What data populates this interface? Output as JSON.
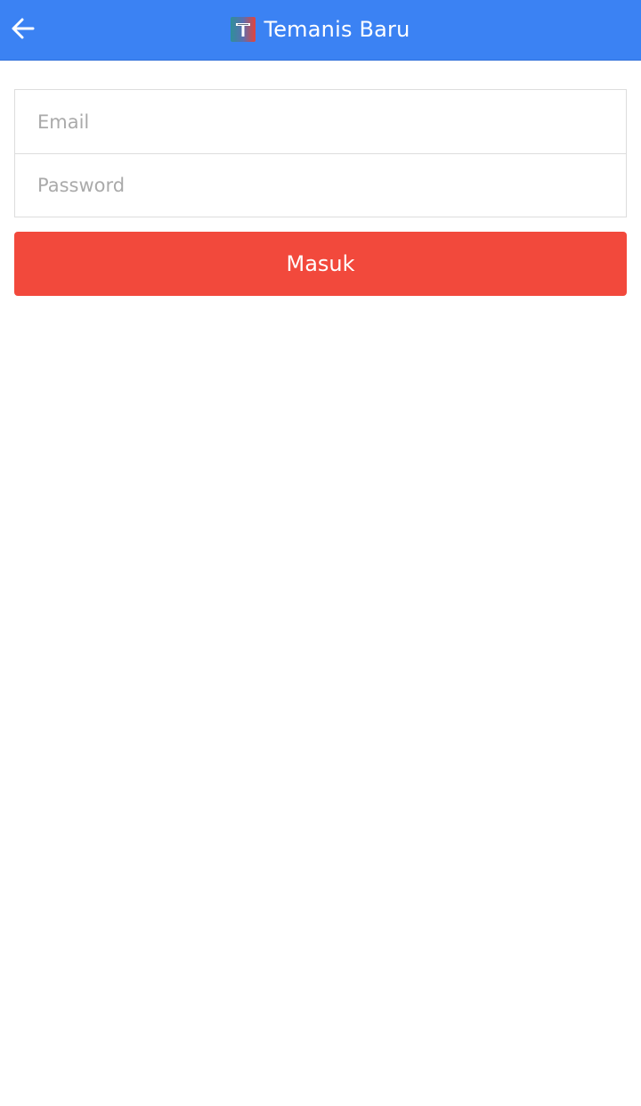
{
  "header": {
    "title": "Temanis Baru",
    "back_icon": "arrow-left-icon",
    "logo_icon": "temanis-logo-icon",
    "background_color": "#3b82f3"
  },
  "login_form": {
    "email_placeholder": "Email",
    "email_value": "",
    "password_placeholder": "Password",
    "password_value": "",
    "submit_label": "Masuk",
    "submit_color": "#f2493c"
  }
}
